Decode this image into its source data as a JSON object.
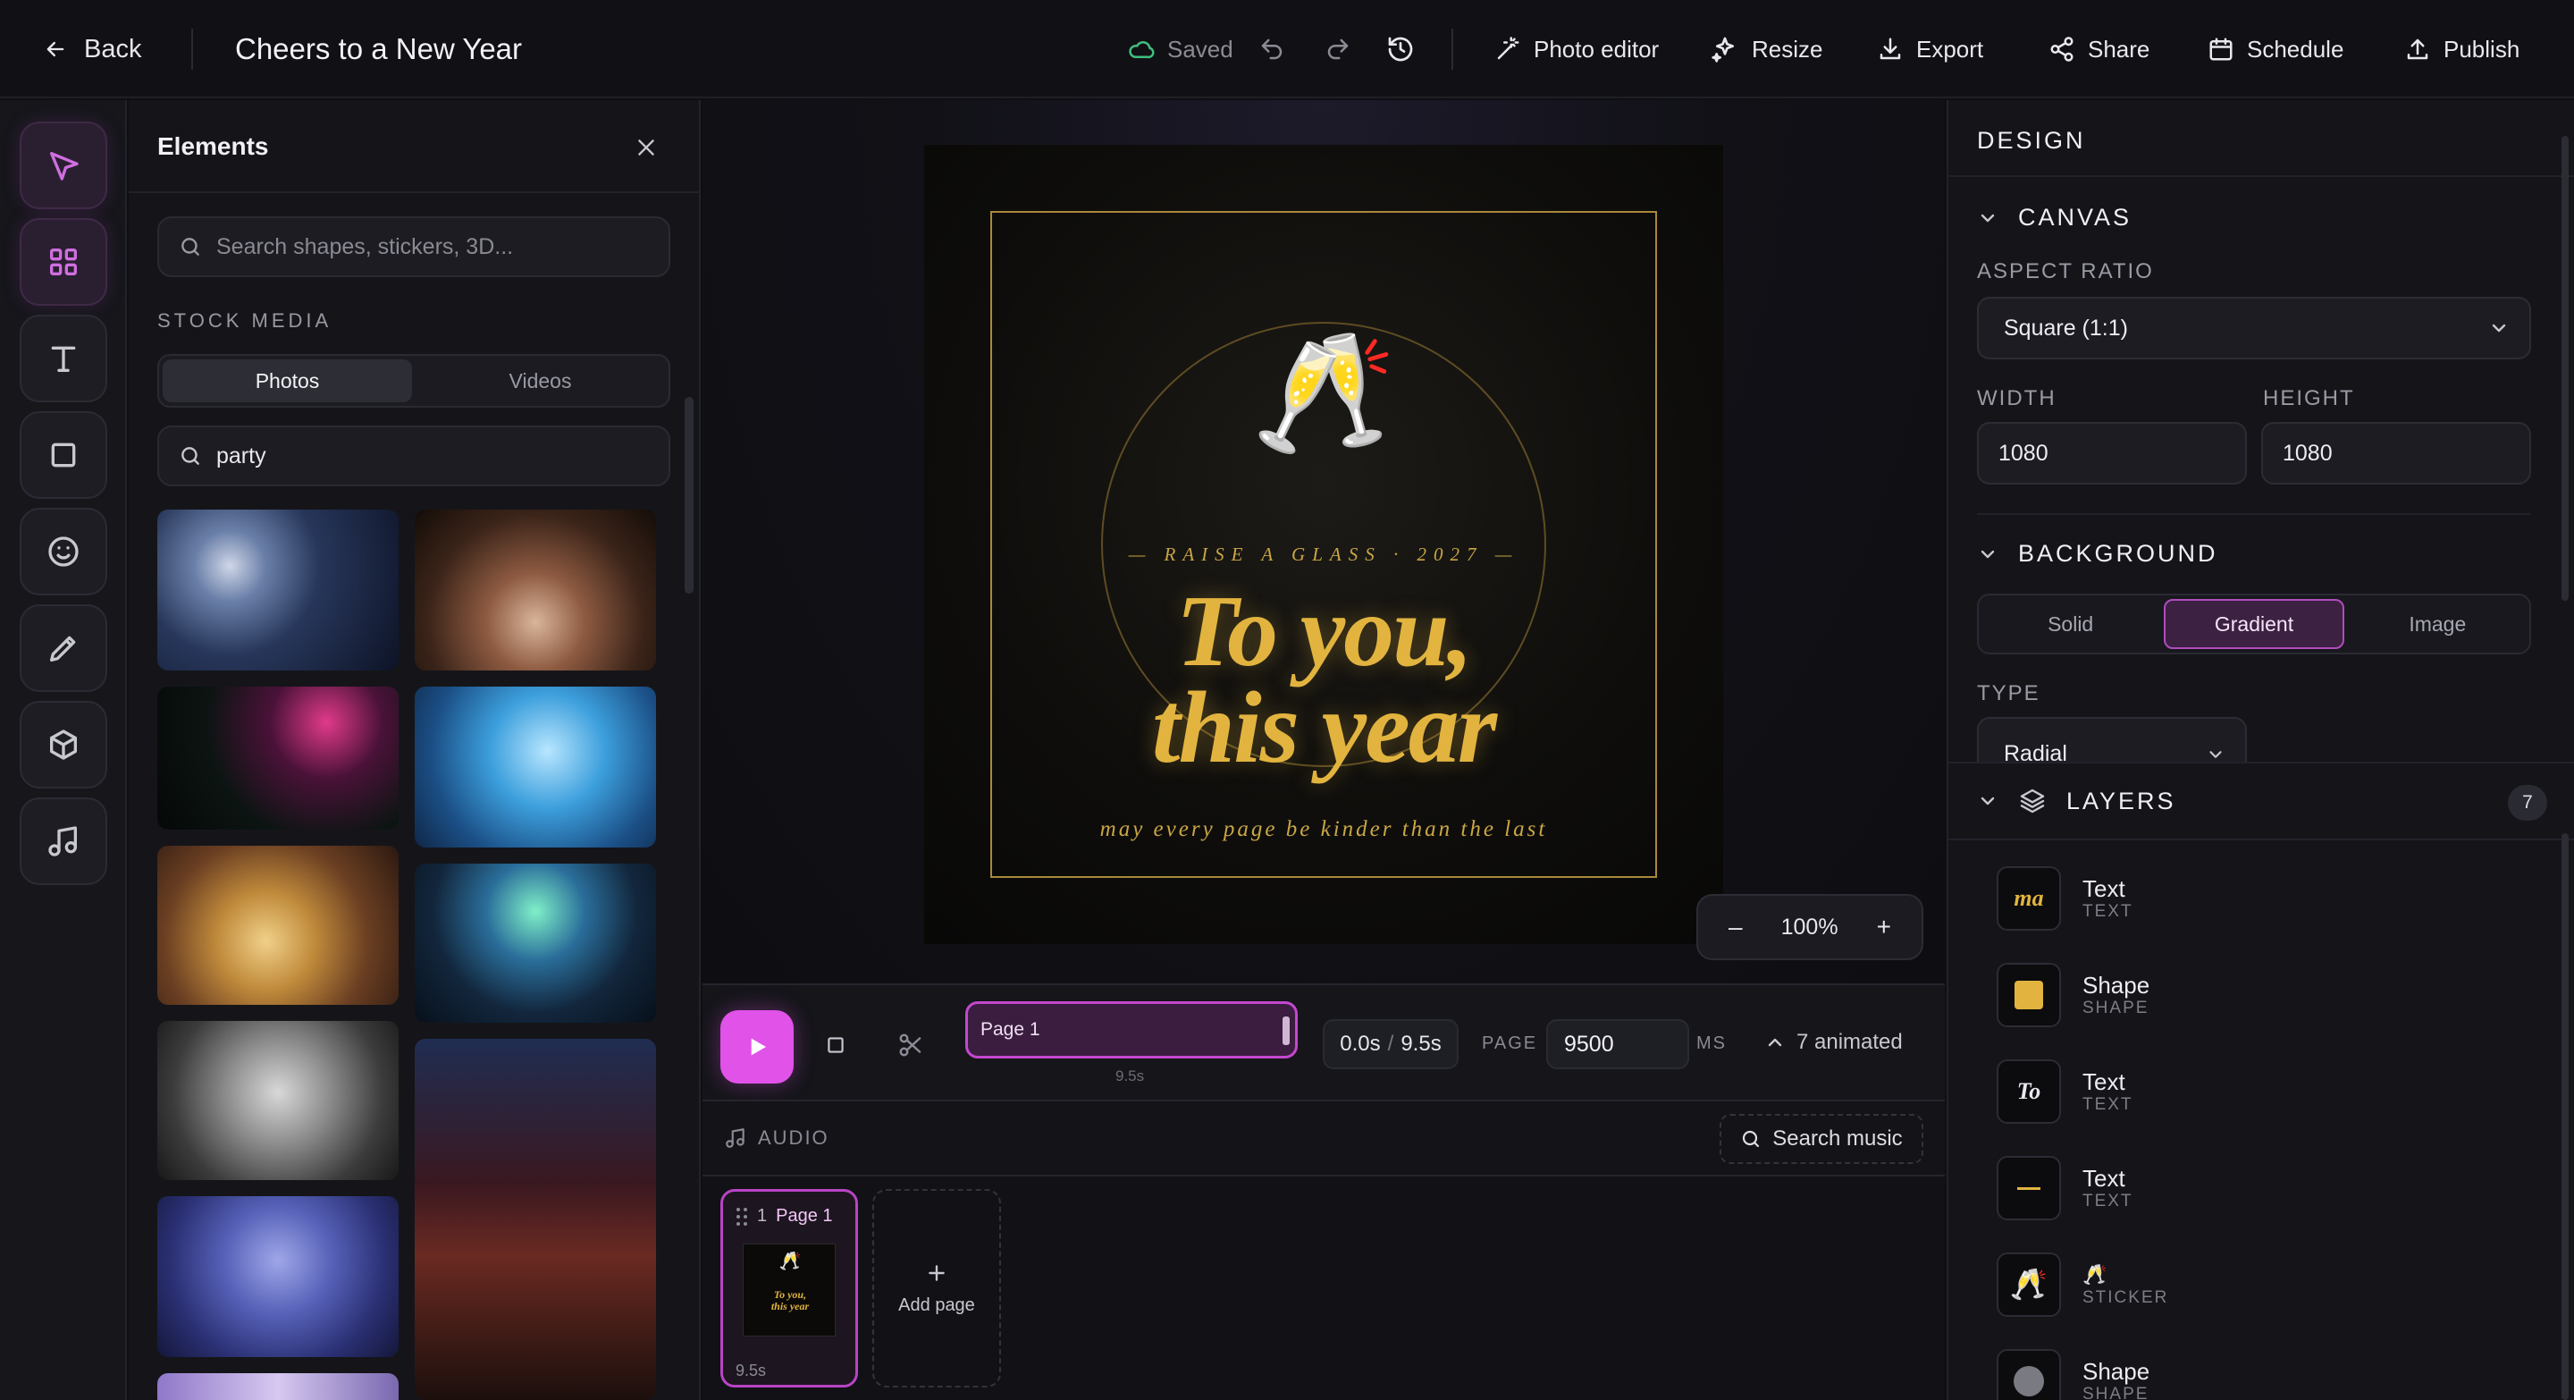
{
  "topbar": {
    "back_label": "Back",
    "title": "Cheers to a New Year",
    "saved_label": "Saved",
    "photo_editor_label": "Photo editor",
    "resize_label": "Resize",
    "export_label": "Export",
    "share_label": "Share",
    "schedule_label": "Schedule",
    "publish_label": "Publish"
  },
  "rail": {
    "items": [
      "select-tool",
      "elements",
      "text",
      "shapes",
      "emoji",
      "draw",
      "3d",
      "audio"
    ]
  },
  "elements_panel": {
    "title": "Elements",
    "search_placeholder": "Search shapes, stickers, 3D...",
    "section_label": "STOCK MEDIA",
    "tabs": [
      "Photos",
      "Videos"
    ],
    "active_tab": "Photos",
    "query": "party"
  },
  "canvas": {
    "sticker": "🥂",
    "eyebrow": "— RAISE A GLASS · 2027 —",
    "headline_line1": "To you,",
    "headline_line2": "this year",
    "tagline": "may every page be kinder than the last",
    "zoom_minus": "–",
    "zoom_value": "100%",
    "zoom_plus": "+",
    "accent_color": "#e2b43f"
  },
  "timeline": {
    "clip_label": "Page 1",
    "clip_duration": "9.5s",
    "current_time": "0.0s",
    "total_time": "9.5s",
    "page_label": "PAGE",
    "page_ms": "9500",
    "ms_label": "MS",
    "animated_label": "7 animated"
  },
  "audio": {
    "label": "AUDIO",
    "search_music_label": "Search music"
  },
  "pages": {
    "page_number": "1",
    "page_name": "Page 1",
    "page_duration": "9.5s",
    "thumb_line1": "To you,",
    "thumb_line2": "this year",
    "add_page_label": "Add page"
  },
  "design": {
    "header": "DESIGN",
    "canvas_section": "CANVAS",
    "aspect_ratio_label": "ASPECT RATIO",
    "aspect_ratio_value": "Square (1:1)",
    "width_label": "WIDTH",
    "width_value": "1080",
    "height_label": "HEIGHT",
    "height_value": "1080",
    "background_section": "BACKGROUND",
    "background_options": [
      "Solid",
      "Gradient",
      "Image"
    ],
    "background_active": "Gradient",
    "type_label": "TYPE",
    "type_value": "Radial",
    "layers_section": "LAYERS",
    "layers_count": "7",
    "layers": [
      {
        "name": "Text",
        "type": "TEXT",
        "thumb": "ma"
      },
      {
        "name": "Shape",
        "type": "SHAPE",
        "thumb": "gold-square"
      },
      {
        "name": "Text",
        "type": "TEXT",
        "thumb": "To"
      },
      {
        "name": "Text",
        "type": "TEXT",
        "thumb": "dash"
      },
      {
        "name": "🥂",
        "type": "STICKER",
        "thumb": "🥂"
      },
      {
        "name": "Shape",
        "type": "SHAPE",
        "thumb": "gray-circle"
      }
    ]
  }
}
